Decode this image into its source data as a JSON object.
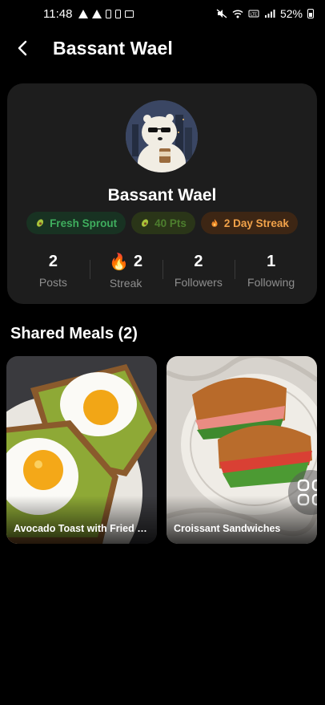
{
  "status_bar": {
    "time": "11:48",
    "battery": "52%",
    "icons": [
      "alert-icon",
      "alert-icon",
      "phone-icon",
      "phone-icon",
      "gallery-icon",
      "mute-icon",
      "wifi-icon",
      "volte-icon",
      "signal-icon",
      "battery-icon"
    ]
  },
  "header": {
    "title": "Bassant Wael",
    "back_icon": "chevron-left-icon"
  },
  "profile": {
    "name": "Bassant Wael",
    "avatar": "bear-with-sunglasses-avatar",
    "badges": [
      {
        "label": "Fresh Sprout",
        "icon": "avocado-icon",
        "color": "#3fae5e"
      },
      {
        "label": "40 Pts",
        "icon": "avocado-icon",
        "color": "#4d7e2e"
      },
      {
        "label": "2 Day Streak",
        "icon": "flame-icon",
        "color": "#f1a24a"
      }
    ],
    "stats": [
      {
        "value": "2",
        "label": "Posts"
      },
      {
        "value": "2",
        "label": "Streak",
        "icon": "flame-icon"
      },
      {
        "value": "2",
        "label": "Followers"
      },
      {
        "value": "1",
        "label": "Following"
      }
    ]
  },
  "shared_meals": {
    "title": "Shared Meals (2)",
    "items": [
      {
        "title": "Avocado Toast with Fried Eggs"
      },
      {
        "title": "Croissant Sandwiches"
      }
    ]
  },
  "colors": {
    "background": "#000000",
    "card": "#1d1d1d",
    "accent_green": "#3fae5e",
    "accent_orange": "#f1a24a"
  }
}
